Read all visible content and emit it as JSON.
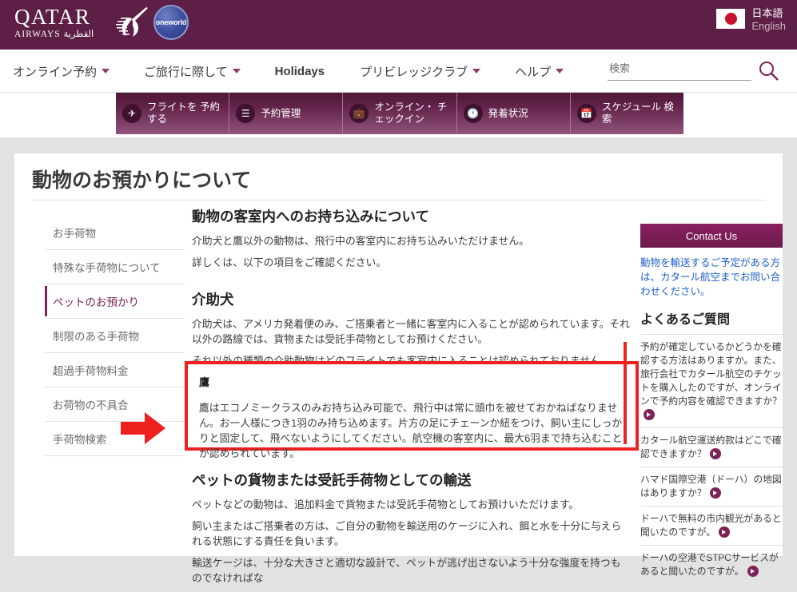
{
  "header": {
    "brand_name": "QATAR",
    "brand_sub": "AIRWAYS",
    "brand_arabic": "القطرية",
    "alliance_logo": "oneworld",
    "language_jp": "日本語",
    "language_en": "English",
    "bg_color": "#5d1f45"
  },
  "nav": {
    "items": [
      {
        "label": "オンライン予約",
        "has_caret": true
      },
      {
        "label": "ご旅行に際して",
        "has_caret": true
      },
      {
        "label": "Holidays",
        "has_caret": false
      },
      {
        "label": "プリビレッジクラブ",
        "has_caret": true
      },
      {
        "label": "ヘルプ",
        "has_caret": true
      }
    ],
    "search_placeholder": "検索",
    "search_value": ""
  },
  "booking_bar": {
    "tabs": [
      {
        "label": "フライトを 予約する",
        "icon": "airplane-icon"
      },
      {
        "label": "予約管理",
        "icon": "list-icon"
      },
      {
        "label": "オンライン・ チェックイン",
        "icon": "suitcase-icon"
      },
      {
        "label": "発着状況",
        "icon": "clock-icon"
      },
      {
        "label": "スケジュール 検索",
        "icon": "calendar-icon"
      }
    ]
  },
  "page": {
    "title": "動物のお預かりについて"
  },
  "sidebar": {
    "items": [
      {
        "label": "お手荷物",
        "active": false
      },
      {
        "label": "特殊な手荷物について",
        "active": false
      },
      {
        "label": "ペットのお預かり",
        "active": true
      },
      {
        "label": "制限のある手荷物",
        "active": false
      },
      {
        "label": "超過手荷物料金",
        "active": false
      },
      {
        "label": "お荷物の不具合",
        "active": false
      },
      {
        "label": "手荷物検索",
        "active": false
      }
    ]
  },
  "main": {
    "section1_heading": "動物の客室内へのお持ち込みについて",
    "section1_p1": "介助犬と鷹以外の動物は、飛行中の客室内にお持ち込みいただけません。",
    "section1_p2": "詳しくは、以下の項目をご確認ください。",
    "section2_heading": "介助犬",
    "section2_p1": "介助犬は、アメリカ発着便のみ、ご搭乗者と一緒に客室内に入ることが認められています。それ以外の路線では、貨物または受託手荷物としてお預けください。",
    "section2_p2": "それ以外の種類の介助動物はどのフライトでも客室内に入ることは認められておりません。",
    "highlight_title": "鷹",
    "highlight_text": "鷹はエコノミークラスのみお持ち込み可能で、飛行中は常に頭巾を被せておかねばなりません。お一人様につき1羽のみ持ち込めます。片方の足にチェーンか紐をつけ、飼い主にしっかりと固定して、飛べないようにしてください。航空機の客室内に、最大6羽まで持ち込むことが認められています。",
    "section3_heading": "ペットの貨物または受託手荷物としての輸送",
    "section3_p1": "ペットなどの動物は、追加料金で貨物または受託手荷物としてお預けいただけます。",
    "section3_p2": "飼い主またはご搭乗者の方は、ご自分の動物を輸送用のケージに入れ、餌と水を十分に与えられる状態にする責任を負います。",
    "section3_p3": "輸送ケージは、十分な大きさと適切な設計で、ペットが逃げ出さないよう十分な強度を持つものでなければな"
  },
  "right_rail": {
    "contact_label": "Contact Us",
    "note": "動物を輸送するご予定がある方は、カタール航空までお問い合わせください。",
    "faq_heading": "よくあるご質問",
    "faq_items": [
      "予約が確定しているかどうかを確認する方法はありますか。また、旅行会社でカタール航空のチケットを購入したのですが、オンラインで予約内容を確認できますか？",
      "カタール航空運送約款はどこで確認できますか？",
      "ハマド国際空港（ドーハ）の地図はありますか？",
      "ドーハで無料の市内観光があると聞いたのですが。",
      "ドーハの空港でSTPCサービスがあると聞いたのですが。"
    ]
  },
  "annotation": {
    "highlight_color": "#ef2020",
    "arrow_name": "red-arrow-pointer"
  }
}
